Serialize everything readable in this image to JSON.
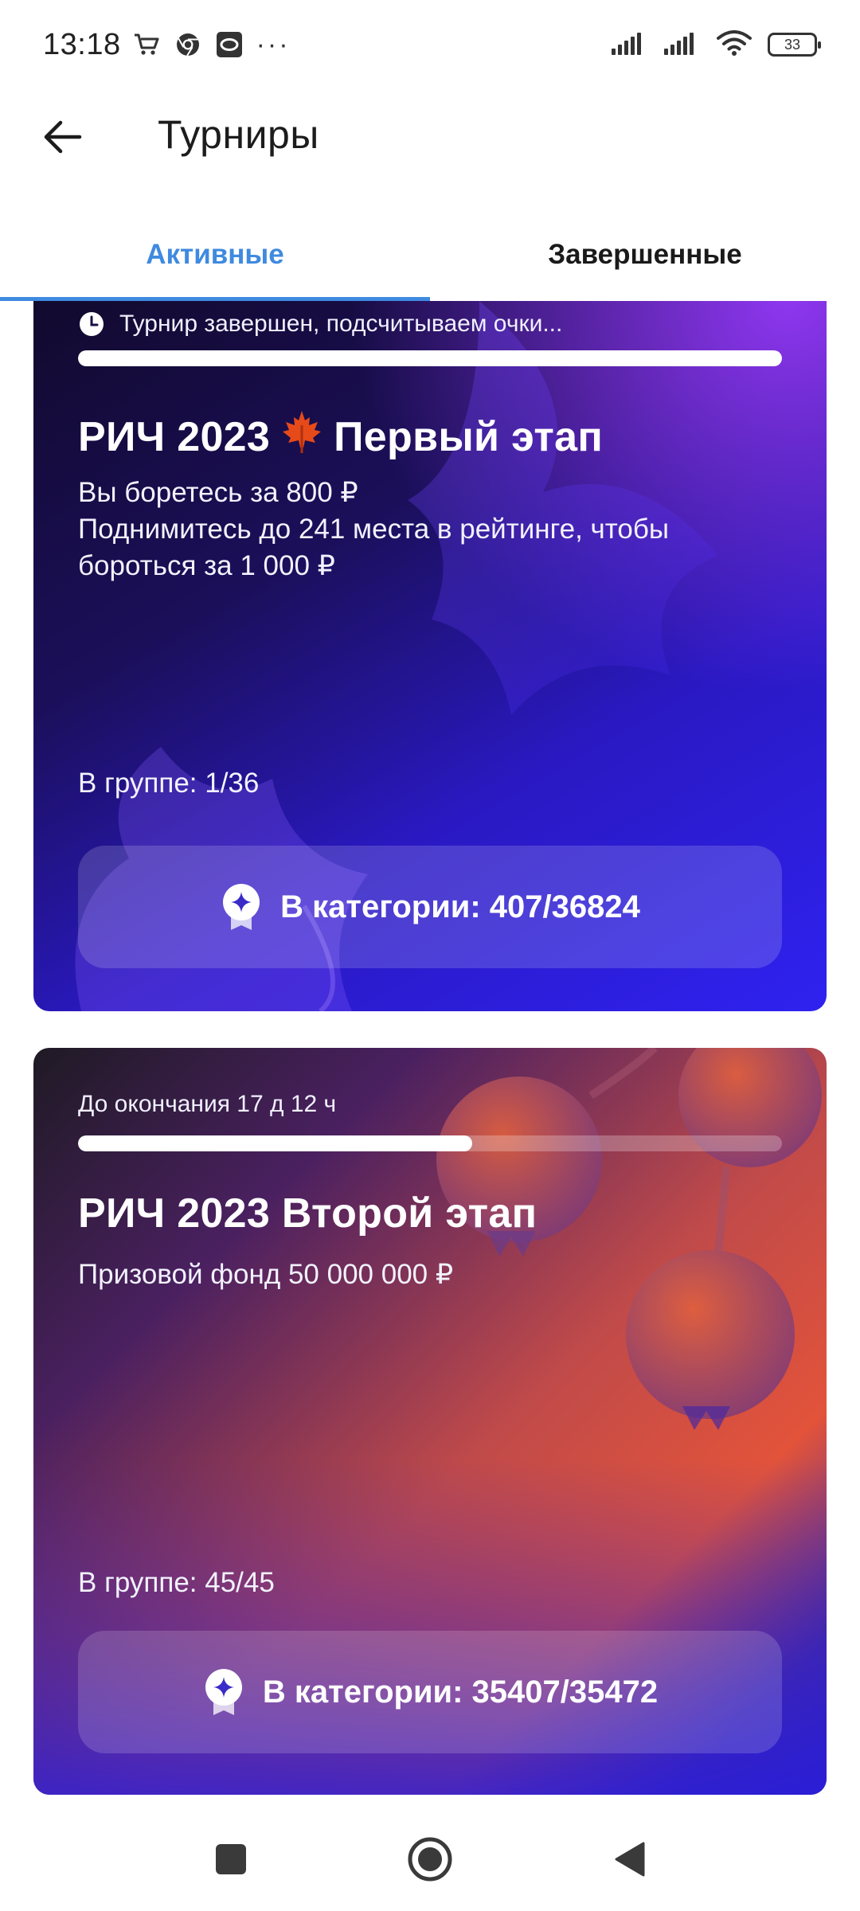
{
  "status_bar": {
    "time": "13:18",
    "dots": "···",
    "battery": "33",
    "left_icons": [
      "cart-icon",
      "chrome-icon",
      "messenger-icon"
    ],
    "right_icons": [
      "signal-icon",
      "signal-icon",
      "wifi-icon",
      "battery-icon"
    ]
  },
  "header": {
    "title": "Турниры",
    "back_icon": "arrow-left-icon"
  },
  "tabs": [
    {
      "label": "Активные",
      "active": true
    },
    {
      "label": "Завершенные",
      "active": false
    }
  ],
  "colors": {
    "accent": "#3f8ae0",
    "card1": [
      "#120a2e",
      "#2f22f0"
    ],
    "card2": [
      "#1f1a24",
      "#e2533a",
      "#2e1fc8"
    ]
  },
  "cards": [
    {
      "status_icon": "clock-icon",
      "status": "Турнир завершен, подсчитываем очки...",
      "progress": 1.0,
      "title_part1": "РИЧ 2023",
      "title_emoji": "🍁",
      "title_part2": "Первый этап",
      "desc": [
        "Вы боретесь за 800 ₽",
        "Поднимитесь до 241 места в рейтинге, чтобы",
        "бороться за 1 000 ₽"
      ],
      "group": "В группе: 1/36",
      "category": "В категории: 407/36824",
      "category_icon": "medal-icon"
    },
    {
      "status": "До окончания 17 д 12 ч",
      "progress": 0.56,
      "title": "РИЧ 2023 Второй этап",
      "desc": [
        "Призовой фонд 50 000 000 ₽"
      ],
      "group": "В группе: 45/45",
      "category": "В категории: 35407/35472",
      "category_icon": "medal-icon"
    }
  ],
  "nav_bar": {
    "buttons": [
      "recents-icon",
      "home-icon",
      "back-icon"
    ]
  }
}
